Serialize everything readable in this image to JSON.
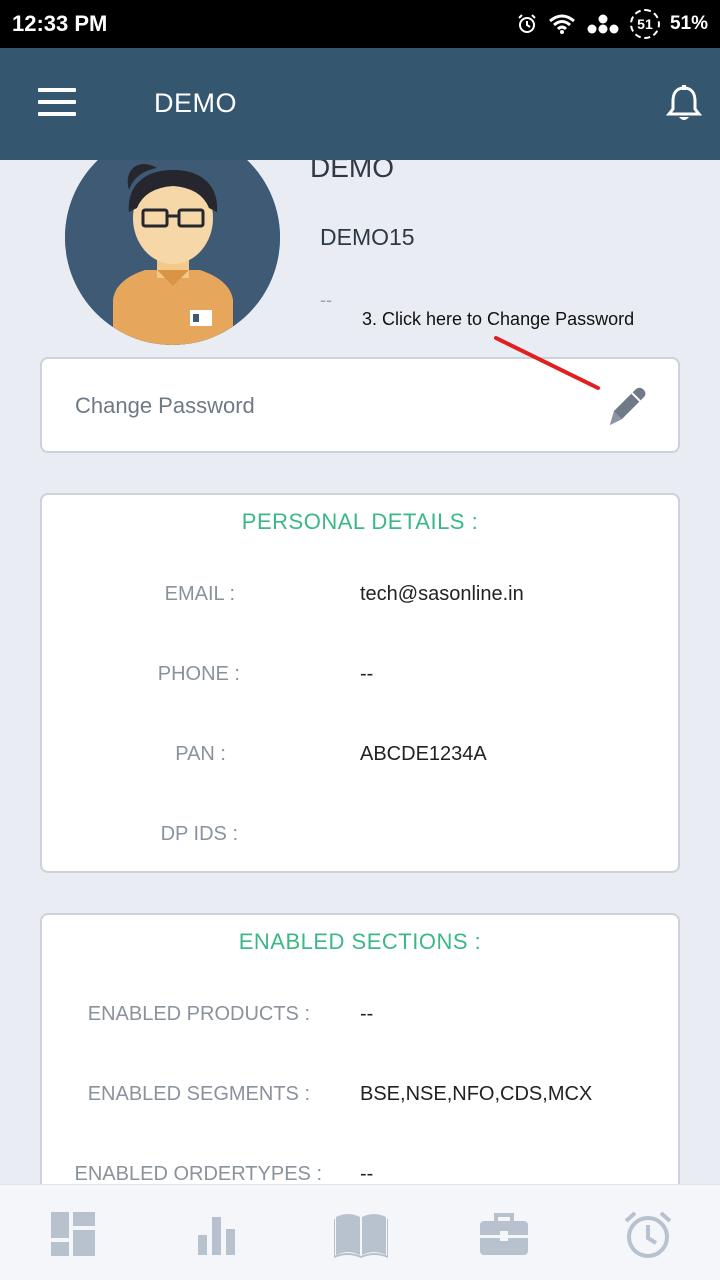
{
  "status_bar": {
    "time": "12:33 PM",
    "battery_percent": "51%",
    "battery_ring": "51",
    "icons": [
      "alarm-icon",
      "wifi-icon",
      "dots-icon",
      "battery-ring-icon"
    ]
  },
  "app_bar": {
    "title": "DEMO",
    "menu_icon": "hamburger-icon",
    "notification_icon": "bell-icon"
  },
  "profile": {
    "name": "DEMO",
    "user_id": "DEMO15",
    "extra": "--",
    "avatar_icon": "user-avatar-icon"
  },
  "annotation": {
    "text": "3. Click here to Change Password"
  },
  "change_password": {
    "label": "Change Password",
    "icon": "pencil-icon"
  },
  "personal_details": {
    "heading": "PERSONAL DETAILS :",
    "rows": [
      {
        "label": "EMAIL :",
        "value": "tech@sasonline.in"
      },
      {
        "label": "PHONE :",
        "value": "--"
      },
      {
        "label": "PAN :",
        "value": "ABCDE1234A"
      },
      {
        "label": "DP IDS :",
        "value": ""
      }
    ]
  },
  "enabled_sections": {
    "heading": "ENABLED SECTIONS :",
    "rows": [
      {
        "label": "ENABLED PRODUCTS :",
        "value": "--"
      },
      {
        "label": "ENABLED SEGMENTS :",
        "value": "BSE,NSE,NFO,CDS,MCX"
      },
      {
        "label": "ENABLED ORDERTYPES :",
        "value": "--"
      }
    ]
  },
  "bottom_nav": {
    "items": [
      "dashboard-icon",
      "bar-chart-icon",
      "book-icon",
      "briefcase-icon",
      "alarm-clock-icon"
    ]
  },
  "colors": {
    "app_bar": "#34576f",
    "background": "#e9ecf3",
    "heading_green": "#3bb886",
    "annotation_arrow": "#e02020",
    "nav_icon": "#b8c2cf"
  }
}
